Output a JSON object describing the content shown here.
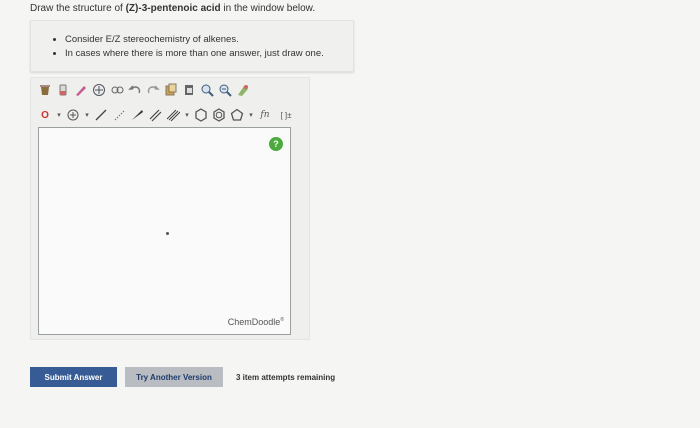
{
  "prompt": {
    "before": "Draw the structure of ",
    "compound": "(Z)-3-pentenoic acid",
    "after": " in the window below."
  },
  "hints": [
    "Consider E/Z stereochemistry of alkenes.",
    "In cases where there is more than one answer, just draw one."
  ],
  "toolbar": {
    "row1": [
      "clear-icon",
      "erase-icon",
      "pen-icon",
      "template-icon",
      "chain-icon",
      "undo-icon",
      "redo-icon",
      "copy-icon",
      "paste-icon",
      "zoom-in-icon",
      "zoom-out-icon",
      "clean-icon"
    ],
    "row2": [
      "element-menu",
      "charge-menu",
      "single-bond",
      "hash-bond",
      "wedge-bond",
      "double-bond",
      "triple-bond",
      "bond-menu",
      "hexagon-ring",
      "benzene-ring",
      "pentagon-ring",
      "ring-menu",
      "function-menu",
      "bracket-menu"
    ],
    "element_label": "O",
    "function_label": "fn",
    "bracket_label": "[ ]±"
  },
  "editor": {
    "help_label": "?",
    "brand": "ChemDoodle"
  },
  "actions": {
    "submit": "Submit Answer",
    "another": "Try Another Version",
    "attempts": "3 item attempts remaining"
  },
  "colors": {
    "submit_bg": "#365b95",
    "another_bg": "#b9bcc0",
    "help_green": "#4caa3f"
  }
}
